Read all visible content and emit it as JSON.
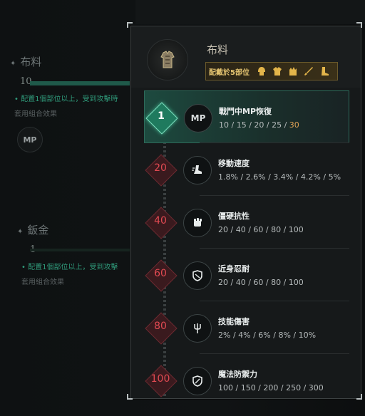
{
  "background": {
    "section1": {
      "title": "布料",
      "count": "10",
      "desc": "• 配置1個部位以上，受到攻擊時",
      "sub": "套用組合效果",
      "mp_icon": "MP"
    },
    "section2": {
      "title": "鈑金",
      "count": "1",
      "desc": "• 配置1個部位以上，受到攻擊",
      "sub": "套用組合效果"
    }
  },
  "card": {
    "title": "布料",
    "equip_label": "配戴於5部位",
    "slot_icons": [
      "helmet-icon",
      "chest-icon",
      "gloves-icon",
      "sword-icon",
      "boots-icon"
    ],
    "armor_icon": "cloth-armor-icon",
    "tiers": [
      {
        "level": "1",
        "icon": "MP",
        "icon_name": "mp-icon",
        "name": "戰鬥中MP恢復",
        "values": "10 / 15 / 20 / 25 / ",
        "highlight": "30",
        "active": true
      },
      {
        "level": "20",
        "icon": "",
        "icon_name": "boot-speed-icon",
        "name": "移動速度",
        "values": "1.8% / 2.6% / 3.4% / 4.2% / 5%",
        "highlight": "",
        "active": false
      },
      {
        "level": "40",
        "icon": "",
        "icon_name": "fist-icon",
        "name": "僵硬抗性",
        "values": "20 / 40 / 60 / 80 / 100",
        "highlight": "",
        "active": false
      },
      {
        "level": "60",
        "icon": "",
        "icon_name": "shield-icon",
        "name": "近身忍耐",
        "values": "20 / 40 / 60 / 80 / 100",
        "highlight": "",
        "active": false
      },
      {
        "level": "80",
        "icon": "",
        "icon_name": "trident-icon",
        "name": "技能傷害",
        "values": "2% / 4% / 6% / 8% / 10%",
        "highlight": "",
        "active": false
      },
      {
        "level": "100",
        "icon": "",
        "icon_name": "magic-shield-icon",
        "name": "魔法防禦力",
        "values": "100 / 150 / 200 / 250 / 300",
        "highlight": "",
        "active": false
      }
    ]
  },
  "colors": {
    "accent_green": "#1f7a5e",
    "tier_red": "#e24a52",
    "gold": "#e3c370",
    "highlight": "#e0a255"
  }
}
